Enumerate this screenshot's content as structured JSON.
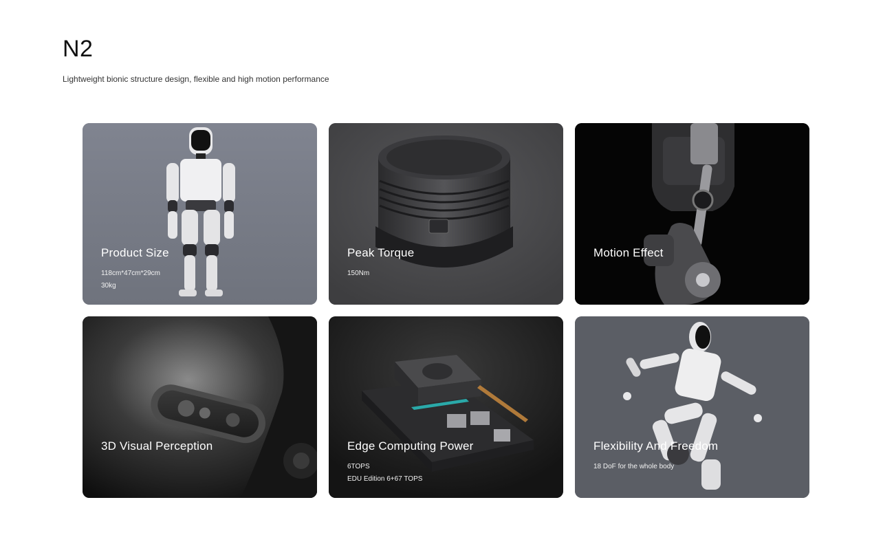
{
  "header": {
    "title": "N2",
    "subtitle": "Lightweight bionic structure design, flexible and high motion performance"
  },
  "cards": [
    {
      "label": "Product Size",
      "lines": [
        "118cm*47cm*29cm",
        "30kg"
      ],
      "image": "humanoid-robot-standing",
      "background": "#7a7e88"
    },
    {
      "label": "Peak Torque",
      "lines": [
        "150Nm"
      ],
      "image": "joint-motor",
      "background": "#4a4a4c"
    },
    {
      "label": "Motion Effect",
      "lines": [],
      "image": "robot-leg-joint",
      "background": "#060606"
    },
    {
      "label": "3D Visual Perception",
      "lines": [],
      "image": "depth-camera",
      "background": "#1f1f1f"
    },
    {
      "label": "Edge Computing Power",
      "lines": [
        "6TOPS",
        "EDU Edition 6+67 TOPS"
      ],
      "image": "compute-board",
      "background": "#242424"
    },
    {
      "label": "Flexibility And Freedom",
      "lines": [
        "18 DoF for the whole body"
      ],
      "image": "humanoid-robot-running",
      "background": "#5b5e65"
    }
  ]
}
